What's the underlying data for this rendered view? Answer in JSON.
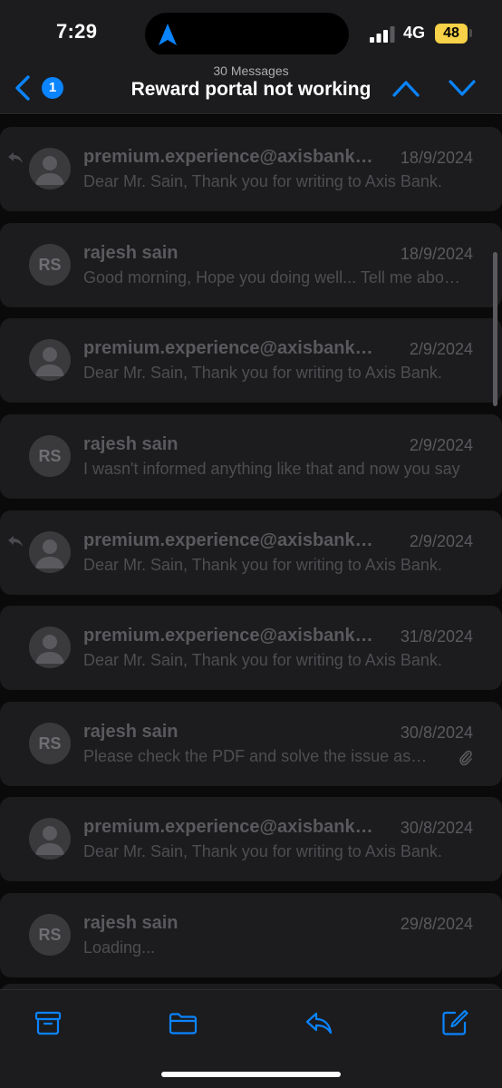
{
  "status": {
    "time": "7:29",
    "network": "4G",
    "battery": "48"
  },
  "nav": {
    "back_count": "1",
    "message_count": "30 Messages",
    "title": "Reward portal not working"
  },
  "messages": [
    {
      "sender": "premium.experience@axisbank.com",
      "date": "18/9/2024",
      "preview": "Dear Mr. Sain, Thank you for writing to Axis Bank.",
      "avatar": "person",
      "replied": true,
      "attachment": false
    },
    {
      "sender": "rajesh sain",
      "date": "18/9/2024",
      "preview": "Good morning, Hope you doing well... Tell me about it.",
      "avatar": "RS",
      "replied": false,
      "attachment": false
    },
    {
      "sender": "premium.experience@axisbank.com",
      "date": "2/9/2024",
      "preview": "Dear Mr. Sain, Thank you for writing to Axis Bank.",
      "avatar": "person",
      "replied": false,
      "attachment": false
    },
    {
      "sender": "rajesh sain",
      "date": "2/9/2024",
      "preview": "I wasn't informed anything like that and now you say",
      "avatar": "RS",
      "replied": false,
      "attachment": false
    },
    {
      "sender": "premium.experience@axisbank.com",
      "date": "2/9/2024",
      "preview": "Dear Mr. Sain, Thank you for writing to Axis Bank.",
      "avatar": "person",
      "replied": true,
      "attachment": false
    },
    {
      "sender": "premium.experience@axisbank.com",
      "date": "31/8/2024",
      "preview": "Dear Mr. Sain, Thank you for writing to Axis Bank.",
      "avatar": "person",
      "replied": false,
      "attachment": false
    },
    {
      "sender": "rajesh sain",
      "date": "30/8/2024",
      "preview": "Please check the PDF and solve the issue as soon as",
      "avatar": "RS",
      "replied": false,
      "attachment": true
    },
    {
      "sender": "premium.experience@axisbank.com",
      "date": "30/8/2024",
      "preview": "Dear Mr. Sain, Thank you for writing to Axis Bank.",
      "avatar": "person",
      "replied": false,
      "attachment": false
    },
    {
      "sender": "rajesh sain",
      "date": "29/8/2024",
      "preview": "Loading...",
      "avatar": "RS",
      "replied": false,
      "attachment": false
    }
  ],
  "icons": {
    "archive": "archive-icon",
    "move": "folder-icon",
    "reply": "reply-icon",
    "compose": "compose-icon"
  },
  "colors": {
    "accent": "#0a84ff",
    "battery": "#f7d147",
    "card": "#1c1c1e"
  }
}
